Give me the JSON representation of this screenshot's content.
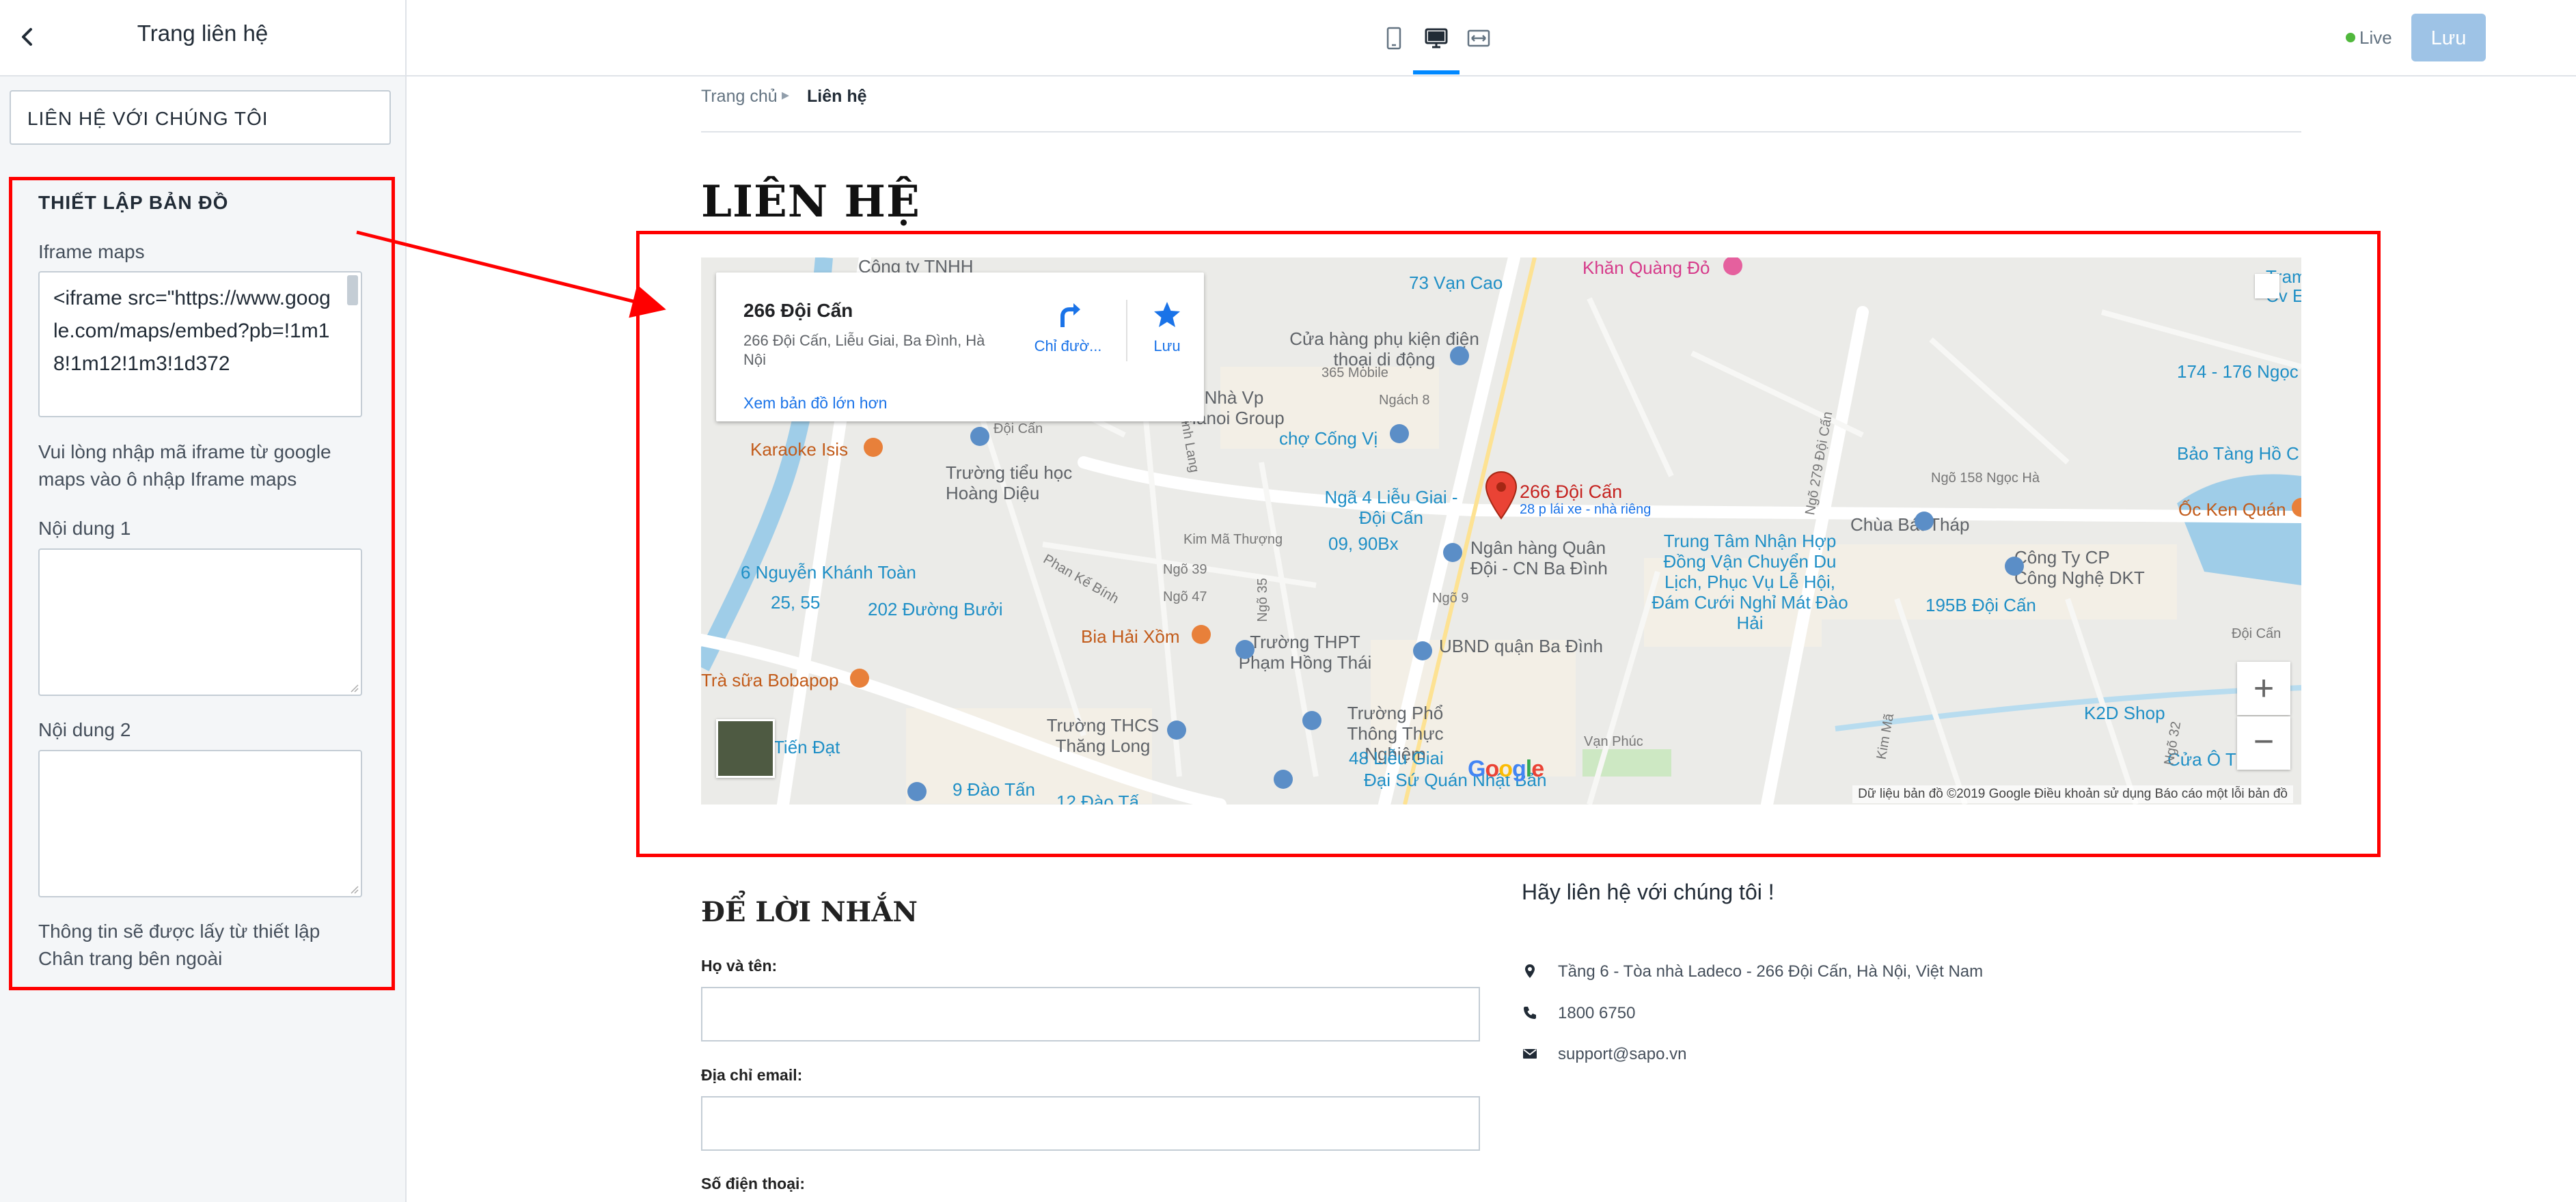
{
  "sidebar": {
    "title": "Trang liên hệ",
    "section1_label": "LIÊN HỆ VỚI CHÚNG TÔI",
    "section2_title": "THIẾT LẬP BẢN ĐỒ",
    "iframe_label": "Iframe maps",
    "iframe_value": "<iframe src=\"https://www.google.com/maps/embed?pb=!1m18!1m12!1m3!1d372",
    "hint": "Vui lòng nhập mã iframe từ google maps vào ô nhập Iframe maps",
    "content1_label": "Nội dung 1",
    "content2_label": "Nội dung 2",
    "footnote": "Thông tin sẽ được lấy từ thiết lập Chân trang bên ngoài"
  },
  "topbar": {
    "devices": [
      "mobile-icon",
      "desktop-icon",
      "fullwidth-icon"
    ],
    "active_device": "desktop-icon",
    "live_label": "Live",
    "save_label": "Lưu"
  },
  "breadcrumb": {
    "home": "Trang chủ",
    "current": "Liên hệ"
  },
  "page_title": "LIÊN HỆ",
  "map": {
    "place_name": "266 Đội Cấn",
    "place_address": "266 Đội Cấn, Liễu Giai, Ba Đình, Hà Nội",
    "directions_label": "Chỉ đườ...",
    "save_label": "Lưu",
    "larger_map_link": "Xem bản đồ lớn hơn",
    "marker_label": "266 Đội Cấn",
    "marker_sub": "28 p lái xe - nhà riêng",
    "attribution": "Dữ liệu bản đồ ©2019 Google   Điều khoản sử dụng   Báo cáo một lỗi bản đồ",
    "logo_text": "Google",
    "labels": [
      "Công ty TNHH",
      "73 Vạn Cao",
      "Khăn Quàng Đỏ",
      "Tram Cv E",
      "Cửa hàng phụ kiện điện thoại di động",
      "365 Mobile",
      "Nhà Vp Hanoi Group",
      "Ngách 8",
      "chợ Cống Vị",
      "Đội Cấn",
      "Karaoke Isis",
      "Trường tiểu học Hoàng Diệu",
      "Linh Lang",
      "Ngõ 279 Đội Cấn",
      "174 - 176 Ngọc",
      "Bảo Tàng Hồ C",
      "Ngõ 158 Ngọc Hà",
      "Ốc Ken Quán",
      "Ngã 4 Liễu Giai - Đội Cấn",
      "09, 90Bx",
      "Ngân hàng Quân Đội - CN Ba Đình",
      "Kim Mã Thượng",
      "Chùa Bát Tháp",
      "Trung Tâm Nhận Hợp Đồng Vận Chuyển Du Lịch, Phục Vụ Lễ Hội, Đám Cưới Nghỉ Mát Đào Hải",
      "Công Ty CP Công Nghệ DKT",
      "6 Nguyễn Khánh Toàn",
      "25, 55",
      "202 Đường Bưởi",
      "Phan Kế Bính",
      "Ngõ 39",
      "Ngõ 47",
      "Ngõ 35",
      "Ngõ 9",
      "195B Đội Cấn",
      "Bia Hải Xồm",
      "Trường THPT Phạm Hồng Thái",
      "UBND quận Ba Đình",
      "Trà sữa Bobapop",
      "Trường THCS Thăng Long",
      "Trường Phổ Thông Thực Nghiệm",
      "48 Liễu Giai",
      "Đại Sứ Quán Nhật Bản",
      "K2D Shop",
      "Cửa Ô T",
      "Vạn Phúc",
      "Kim Mã",
      "Tiến Đạt",
      "9 Đào Tấn",
      "12 Đào Tấ",
      "Ngõ 32",
      "Đội Cấn"
    ]
  },
  "message_form": {
    "title": "ĐỂ LỜI NHẮN",
    "name_label": "Họ và tên:",
    "email_label": "Địa chỉ email:",
    "phone_label": "Số điện thoại:"
  },
  "contact": {
    "title": "Hãy liên hệ với chúng tôi !",
    "address": "Tầng 6 - Tòa nhà Ladeco - 266 Đội Cấn, Hà Nội, Việt Nam",
    "phone": "1800 6750",
    "email": "support@sapo.vn"
  },
  "colors": {
    "accent": "#0088ff",
    "save_button": "#9ec3e6",
    "live": "#50b83c",
    "annotation": "#ff0000"
  }
}
